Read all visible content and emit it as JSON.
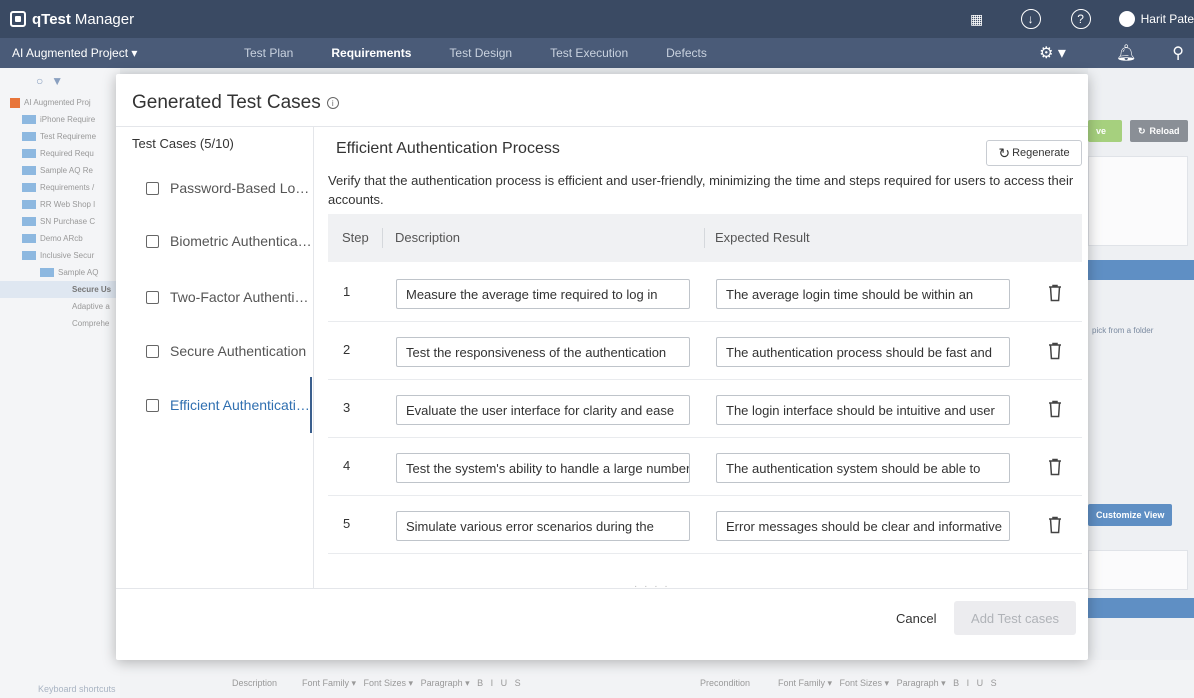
{
  "app": {
    "brand": "qTest",
    "product": "Manager",
    "user": "Harit Pate"
  },
  "nav": {
    "project": "AI Augmented Project ▾",
    "tabs": [
      "Test Plan",
      "Requirements",
      "Test Design",
      "Test Execution",
      "Defects"
    ],
    "active_tab": "Requirements"
  },
  "tree": {
    "items": [
      "AI Augmented Proj",
      "iPhone Require",
      "Test Requireme",
      "Required Requ",
      "Sample AQ Re",
      "Requirements /",
      "RR Web Shop l",
      "SN Purchase C",
      "Demo ARcb",
      "Inclusive Secur",
      "Sample AQ",
      "Secure Us",
      "Adaptive a",
      "Comprehe"
    ],
    "keyboard_shortcuts": "Keyboard shortcuts"
  },
  "right_panel": {
    "reload_label": "Reload",
    "customize_label": "Customize View",
    "folder_hint": "pick from a folder",
    "partial_btn": "ve"
  },
  "bottom": {
    "description_label": "Description",
    "precondition_label": "Precondition",
    "toolbar": "Font Family ▾   Font Sizes ▾   Paragraph ▾   B   I   U   S"
  },
  "modal": {
    "title": "Generated Test Cases",
    "cases_header": "Test Cases (5/10)",
    "cases": [
      "Password-Based Login",
      "Biometric Authentication",
      "Two-Factor Authentication",
      "Secure Authentication",
      "Efficient Authentication Process"
    ],
    "active_case": 4,
    "detail": {
      "title": "Efficient Authentication Process",
      "regenerate_label": "Regenerate",
      "description": "Verify that the authentication process is efficient and user-friendly, minimizing the time and steps required for users to access their accounts.",
      "columns": {
        "step": "Step",
        "description": "Description",
        "expected": "Expected Result"
      },
      "steps": [
        {
          "num": "1",
          "description": "Measure the average time required to log in",
          "expected": "The average login time should be within an"
        },
        {
          "num": "2",
          "description": "Test the responsiveness of the authentication",
          "expected": "The authentication process should be fast and"
        },
        {
          "num": "3",
          "description": "Evaluate the user interface for clarity and ease",
          "expected": "The login interface should be intuitive and user"
        },
        {
          "num": "4",
          "description": "Test the system's ability to handle a large number",
          "expected": "The authentication system should be able to"
        },
        {
          "num": "5",
          "description": "Simulate various error scenarios during the",
          "expected": "Error messages should be clear and informative"
        }
      ]
    },
    "cancel_label": "Cancel",
    "add_label": "Add Test cases"
  },
  "colors": {
    "topbar": "#3a4a63",
    "navbar": "#4a5b78",
    "accent_link": "#2f6fb0",
    "reload_btn": "#8a8f96",
    "customize_btn": "#5f8fc4",
    "partial_btn": "#a6d07e"
  }
}
